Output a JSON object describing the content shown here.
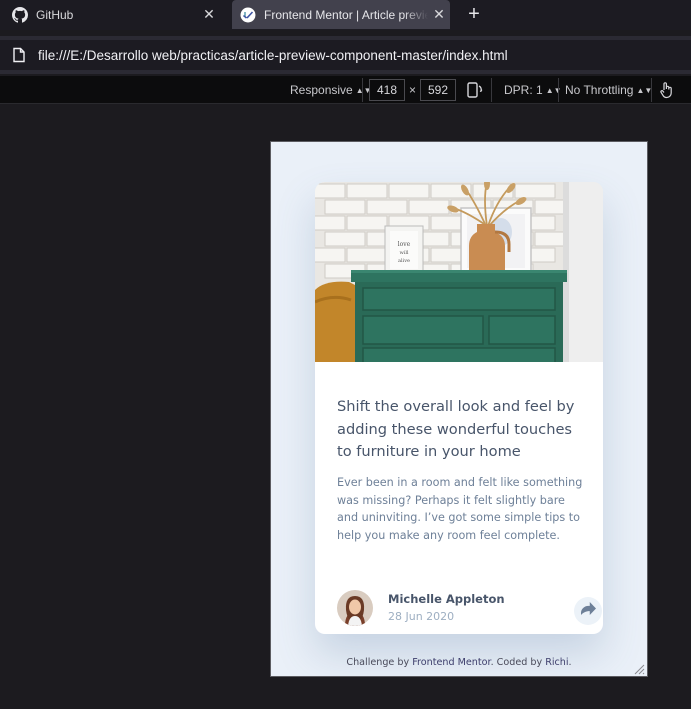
{
  "tabs": [
    {
      "title": "GitHub",
      "icon": "github-icon",
      "close": "✕"
    },
    {
      "title": "Frontend Mentor | Article preview component",
      "icon": "frontend-mentor-icon",
      "close": "✕",
      "active": true
    }
  ],
  "new_tab_label": "+",
  "address_bar": {
    "icon": "page-icon",
    "url": "file:///E:/Desarrollo web/practicas/article-preview-component-master/index.html"
  },
  "rdm_toolbar": {
    "device": "Responsive",
    "width": "418",
    "times": "×",
    "height": "592",
    "dpr": "DPR: 1",
    "throttling": "No Throttling"
  },
  "article": {
    "title": "Shift the overall look and feel by adding these wonderful touches to furniture in your home",
    "description": "Ever been in a room and felt like something was missing? Perhaps it felt slightly bare and uninviting. I’ve got some simple tips to help you make any room feel complete.",
    "author_name": "Michelle Appleton",
    "date": "28 Jun 2020"
  },
  "attribution": {
    "prefix": "Challenge by ",
    "challenge_link": "Frontend Mentor",
    "middle": ". Coded by ",
    "coder_link": "Richi",
    "suffix": "."
  },
  "colors": {
    "card_title": "#48556a",
    "card_text": "#6e8098",
    "date": "#9eafc2",
    "page_bg": "#eaf0f8",
    "cabinet": "#2e7460"
  }
}
